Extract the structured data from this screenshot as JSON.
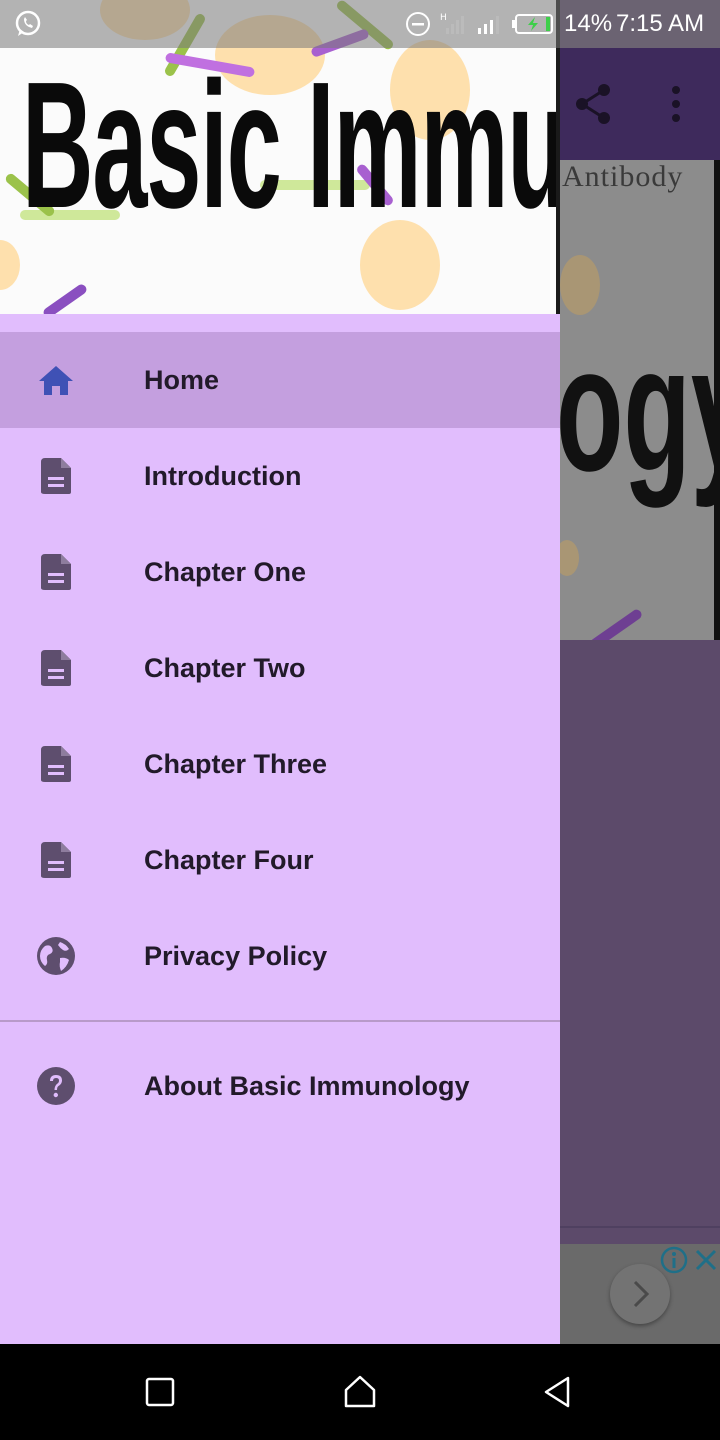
{
  "status_bar": {
    "battery_text": "14%",
    "time": "7:15 AM",
    "icons": [
      "whatsapp-icon",
      "dnd-icon",
      "signal-icon",
      "signal-icon",
      "battery-icon"
    ]
  },
  "app": {
    "toolbar_icons": [
      "share-icon",
      "more-vert-icon"
    ],
    "banner_caption": "Antibody",
    "banner_title_fragment": "ogy"
  },
  "drawer": {
    "header_title": "Basic Immunology",
    "menu": [
      {
        "label": "Home",
        "icon": "home-icon",
        "active": true
      },
      {
        "label": "Introduction",
        "icon": "document-icon",
        "active": false
      },
      {
        "label": "Chapter One",
        "icon": "document-icon",
        "active": false
      },
      {
        "label": "Chapter Two",
        "icon": "document-icon",
        "active": false
      },
      {
        "label": "Chapter Three",
        "icon": "document-icon",
        "active": false
      },
      {
        "label": "Chapter Four",
        "icon": "document-icon",
        "active": false
      },
      {
        "label": "Privacy Policy",
        "icon": "globe-icon",
        "active": false
      }
    ],
    "secondary": [
      {
        "label": "About Basic Immunology",
        "icon": "help-icon"
      }
    ]
  },
  "nav_bar": {
    "buttons": [
      "recents-icon",
      "home-nav-icon",
      "back-icon"
    ]
  },
  "colors": {
    "drawer_bg": "#e1bdfd",
    "active_item_bg": "#c49fdf",
    "icon_color": "#5e4e6e",
    "home_icon_color": "#3f51b5",
    "toolbar_bg": "#3e2a5c",
    "scrim_bg": "#5c4a6a"
  }
}
